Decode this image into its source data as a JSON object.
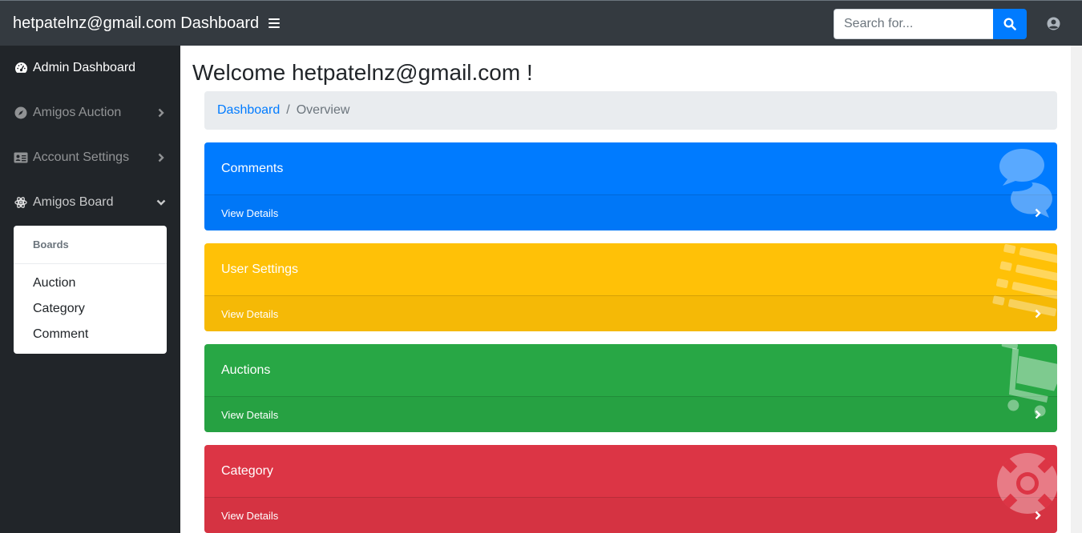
{
  "navbar": {
    "brand": "hetpatelnz@gmail.com Dashboard",
    "search_placeholder": "Search for..."
  },
  "sidebar": {
    "items": [
      {
        "label": "Admin Dashboard",
        "icon": "tachometer-icon"
      },
      {
        "label": "Amigos Auction",
        "icon": "compass-icon"
      },
      {
        "label": "Account Settings",
        "icon": "address-card-icon"
      },
      {
        "label": "Amigos Board",
        "icon": "atom-icon"
      }
    ],
    "dropdown": {
      "header": "Boards",
      "items": [
        "Auction",
        "Category",
        "Comment"
      ]
    }
  },
  "main": {
    "title": "Welcome hetpatelnz@gmail.com !",
    "breadcrumb": {
      "link": "Dashboard",
      "current": "Overview"
    },
    "cards": [
      {
        "title": "Comments",
        "footer": "View Details",
        "color": "#007bff",
        "icon": "comments-icon"
      },
      {
        "title": "User Settings",
        "footer": "View Details",
        "color": "#ffc107",
        "icon": "list-icon"
      },
      {
        "title": "Auctions",
        "footer": "View Details",
        "color": "#28a745",
        "icon": "shopping-cart-icon"
      },
      {
        "title": "Category",
        "footer": "View Details",
        "color": "#dc3545",
        "icon": "life-ring-icon"
      }
    ]
  }
}
